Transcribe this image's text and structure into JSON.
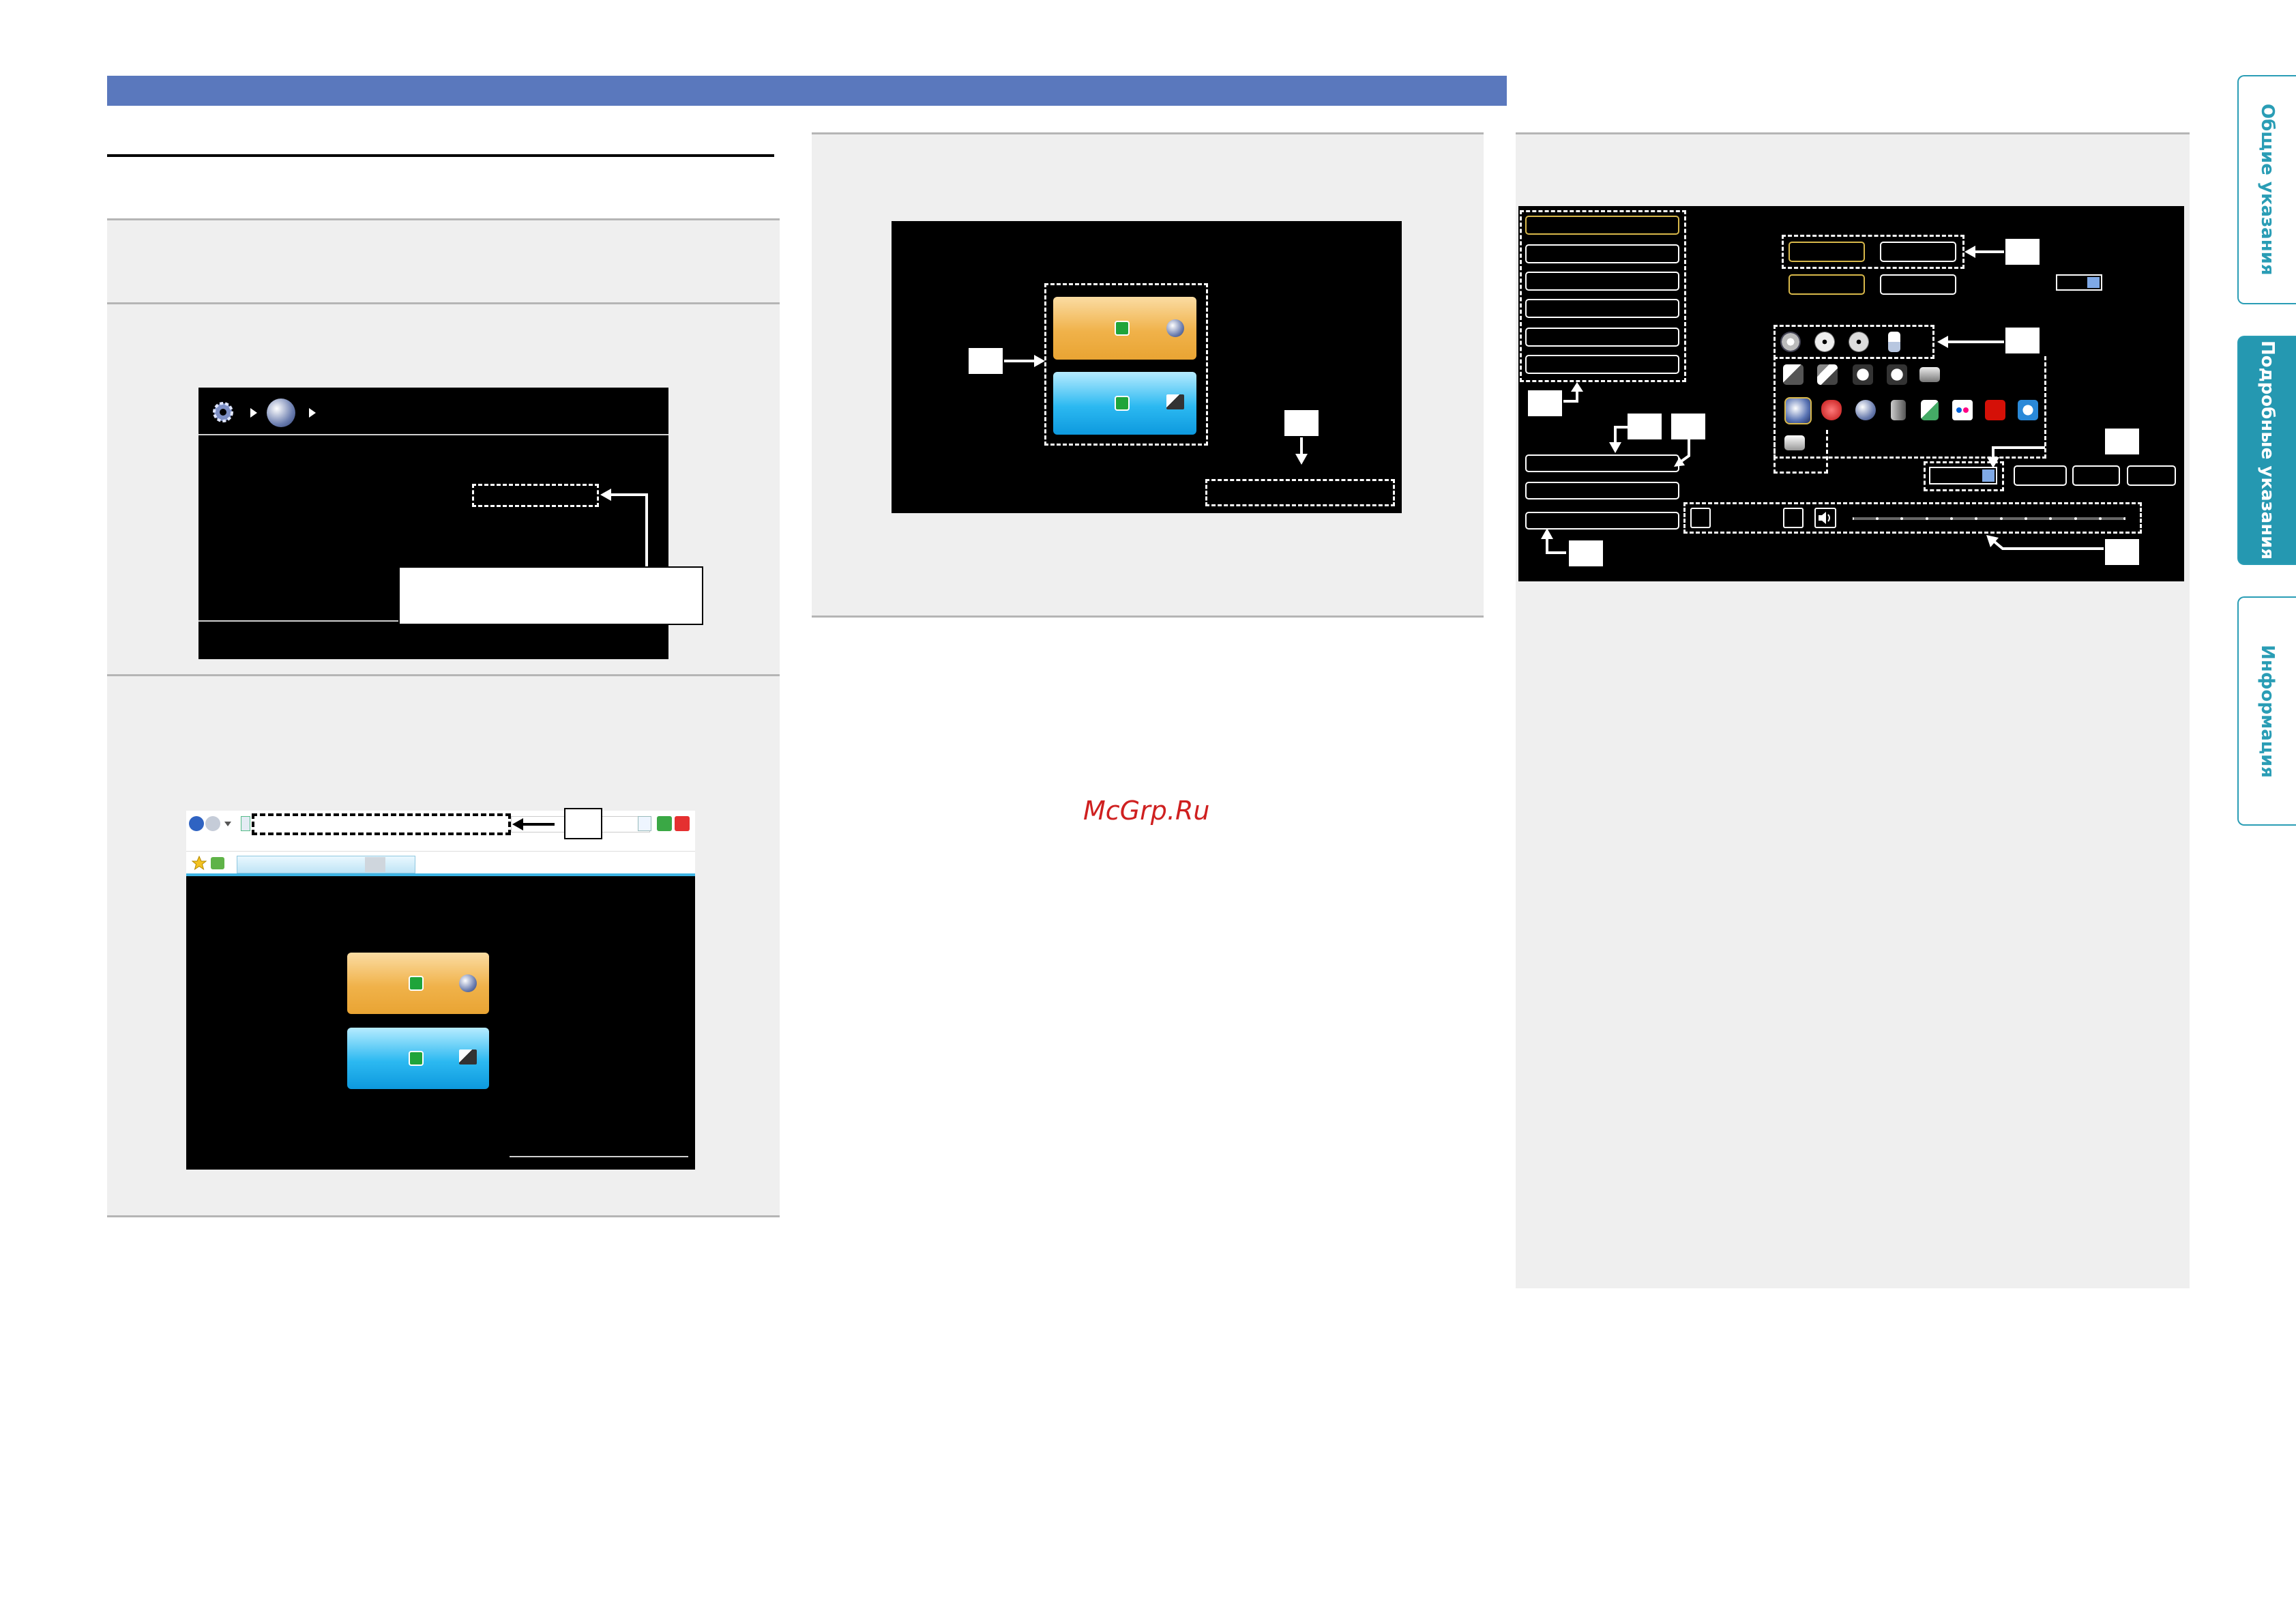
{
  "colors": {
    "header_bar": "#5a78bd",
    "tab_accent": "#2a9db5",
    "tab_active_bg": "#2598b1",
    "watermark": "#cf2020",
    "screen_bg": "#000000",
    "panel_bg": "#efefef"
  },
  "side_tabs": [
    {
      "label": "Общие указания",
      "active": false
    },
    {
      "label": "Подробные указания",
      "active": true
    },
    {
      "label": "Информация",
      "active": false
    }
  ],
  "watermark": "McGrp.Ru",
  "icons": {
    "setup_gear": "gear-icon",
    "network": "globe-icon",
    "power": "power-icon",
    "monitor": "monitor-icon",
    "browser_back": "back-icon",
    "browser_forward": "forward-icon",
    "browser_refresh": "refresh-icon",
    "browser_stop": "close-icon",
    "favorites": "star-icon",
    "dropdown": "chevron-down-icon",
    "volume": "speaker-icon"
  }
}
